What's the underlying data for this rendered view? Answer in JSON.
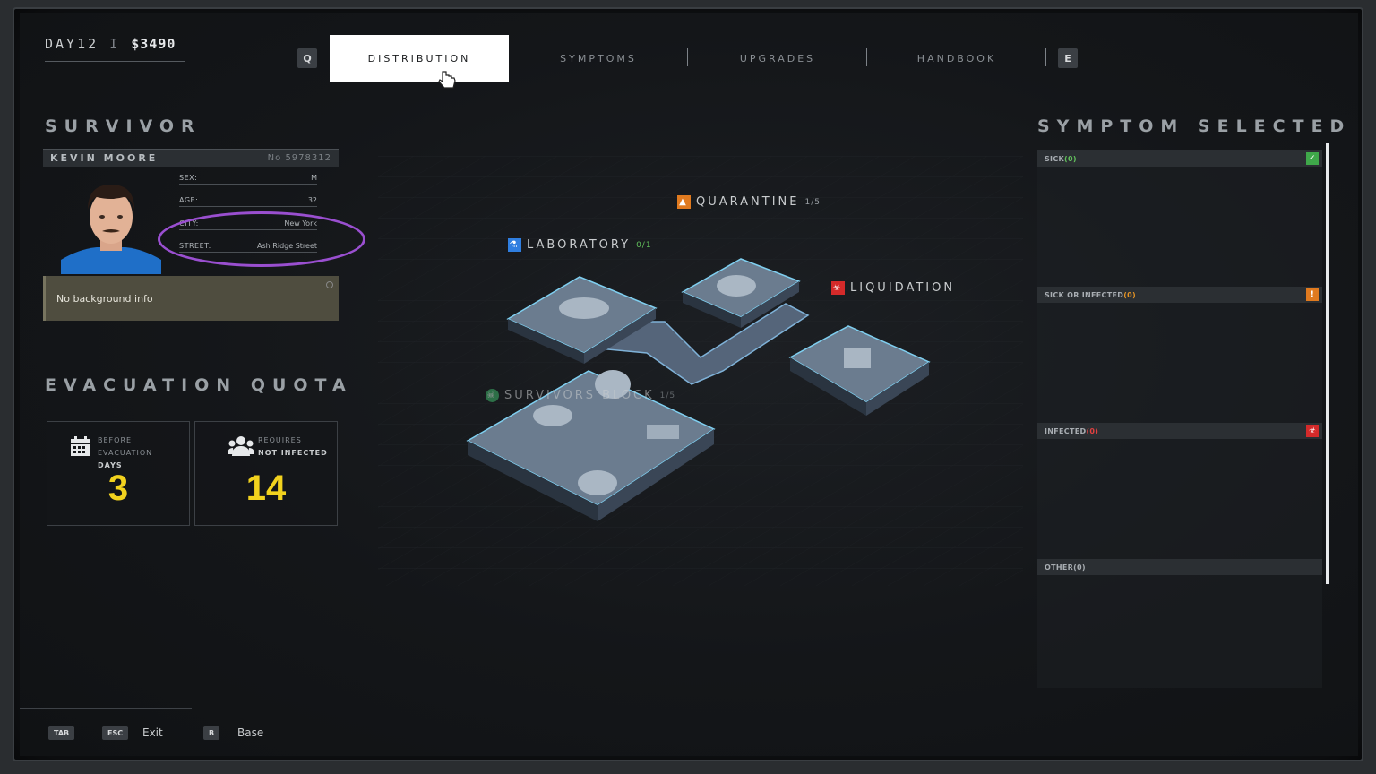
{
  "status": {
    "day": "DAY12",
    "separator": "I",
    "money": "$3490"
  },
  "tabs": {
    "prev_key": "Q",
    "next_key": "E",
    "items": [
      {
        "label": "DISTRIBUTION",
        "active": true
      },
      {
        "label": "SYMPTOMS",
        "active": false
      },
      {
        "label": "UPGRADES",
        "active": false
      },
      {
        "label": "HANDBOOK",
        "active": false
      }
    ]
  },
  "survivor": {
    "section_title": "SURVIVOR",
    "name": "KEVIN MOORE",
    "number": "No 5978312",
    "fields": {
      "sex_label": "SEX:",
      "sex": "M",
      "age_label": "AGE:",
      "age": "32",
      "city_label": "CITY:",
      "city": "New York",
      "street_label": "STREET:",
      "street": "Ash Ridge Street"
    },
    "background": "No background info"
  },
  "quota": {
    "section_title": "EVACUATION QUOTA",
    "days_line1": "BEFORE EVACUATION",
    "days_line2": "DAYS",
    "days_value": "3",
    "people_line1": "REQUIRES",
    "people_line2": "NOT INFECTED",
    "people_value": "14"
  },
  "map": {
    "quarantine": {
      "label": "QUARANTINE",
      "count": "1/5",
      "icon": "warning-icon",
      "color": "#e07a1f"
    },
    "laboratory": {
      "label": "LABORATORY",
      "count": "0/1",
      "icon": "flask-icon",
      "color": "#2f7ee0"
    },
    "liquidation": {
      "label": "LIQUIDATION",
      "icon": "biohazard-icon",
      "color": "#d42a2a"
    },
    "survivors": {
      "label": "SURVIVORS BLOCK",
      "count": "1/5",
      "icon": "skull-icon",
      "color": "#3fb56a"
    }
  },
  "symptoms": {
    "section_title": "SYMPTOM SELECTED",
    "groups": [
      {
        "label": "SICK",
        "count": "(0)",
        "icon": "shield-check-icon",
        "color": "#3fa84a"
      },
      {
        "label": "SICK OR INFECTED",
        "count": "(0)",
        "icon": "warning-icon",
        "color": "#e07a1f"
      },
      {
        "label": "INFECTED",
        "count": "(0)",
        "icon": "biohazard-icon",
        "color": "#d42a2a"
      },
      {
        "label": "OTHER",
        "count": "(0)"
      }
    ]
  },
  "bottom": {
    "tab_key": "TAB",
    "esc_key": "ESC",
    "exit_label": "Exit",
    "b_key": "B",
    "base_label": "Base"
  }
}
